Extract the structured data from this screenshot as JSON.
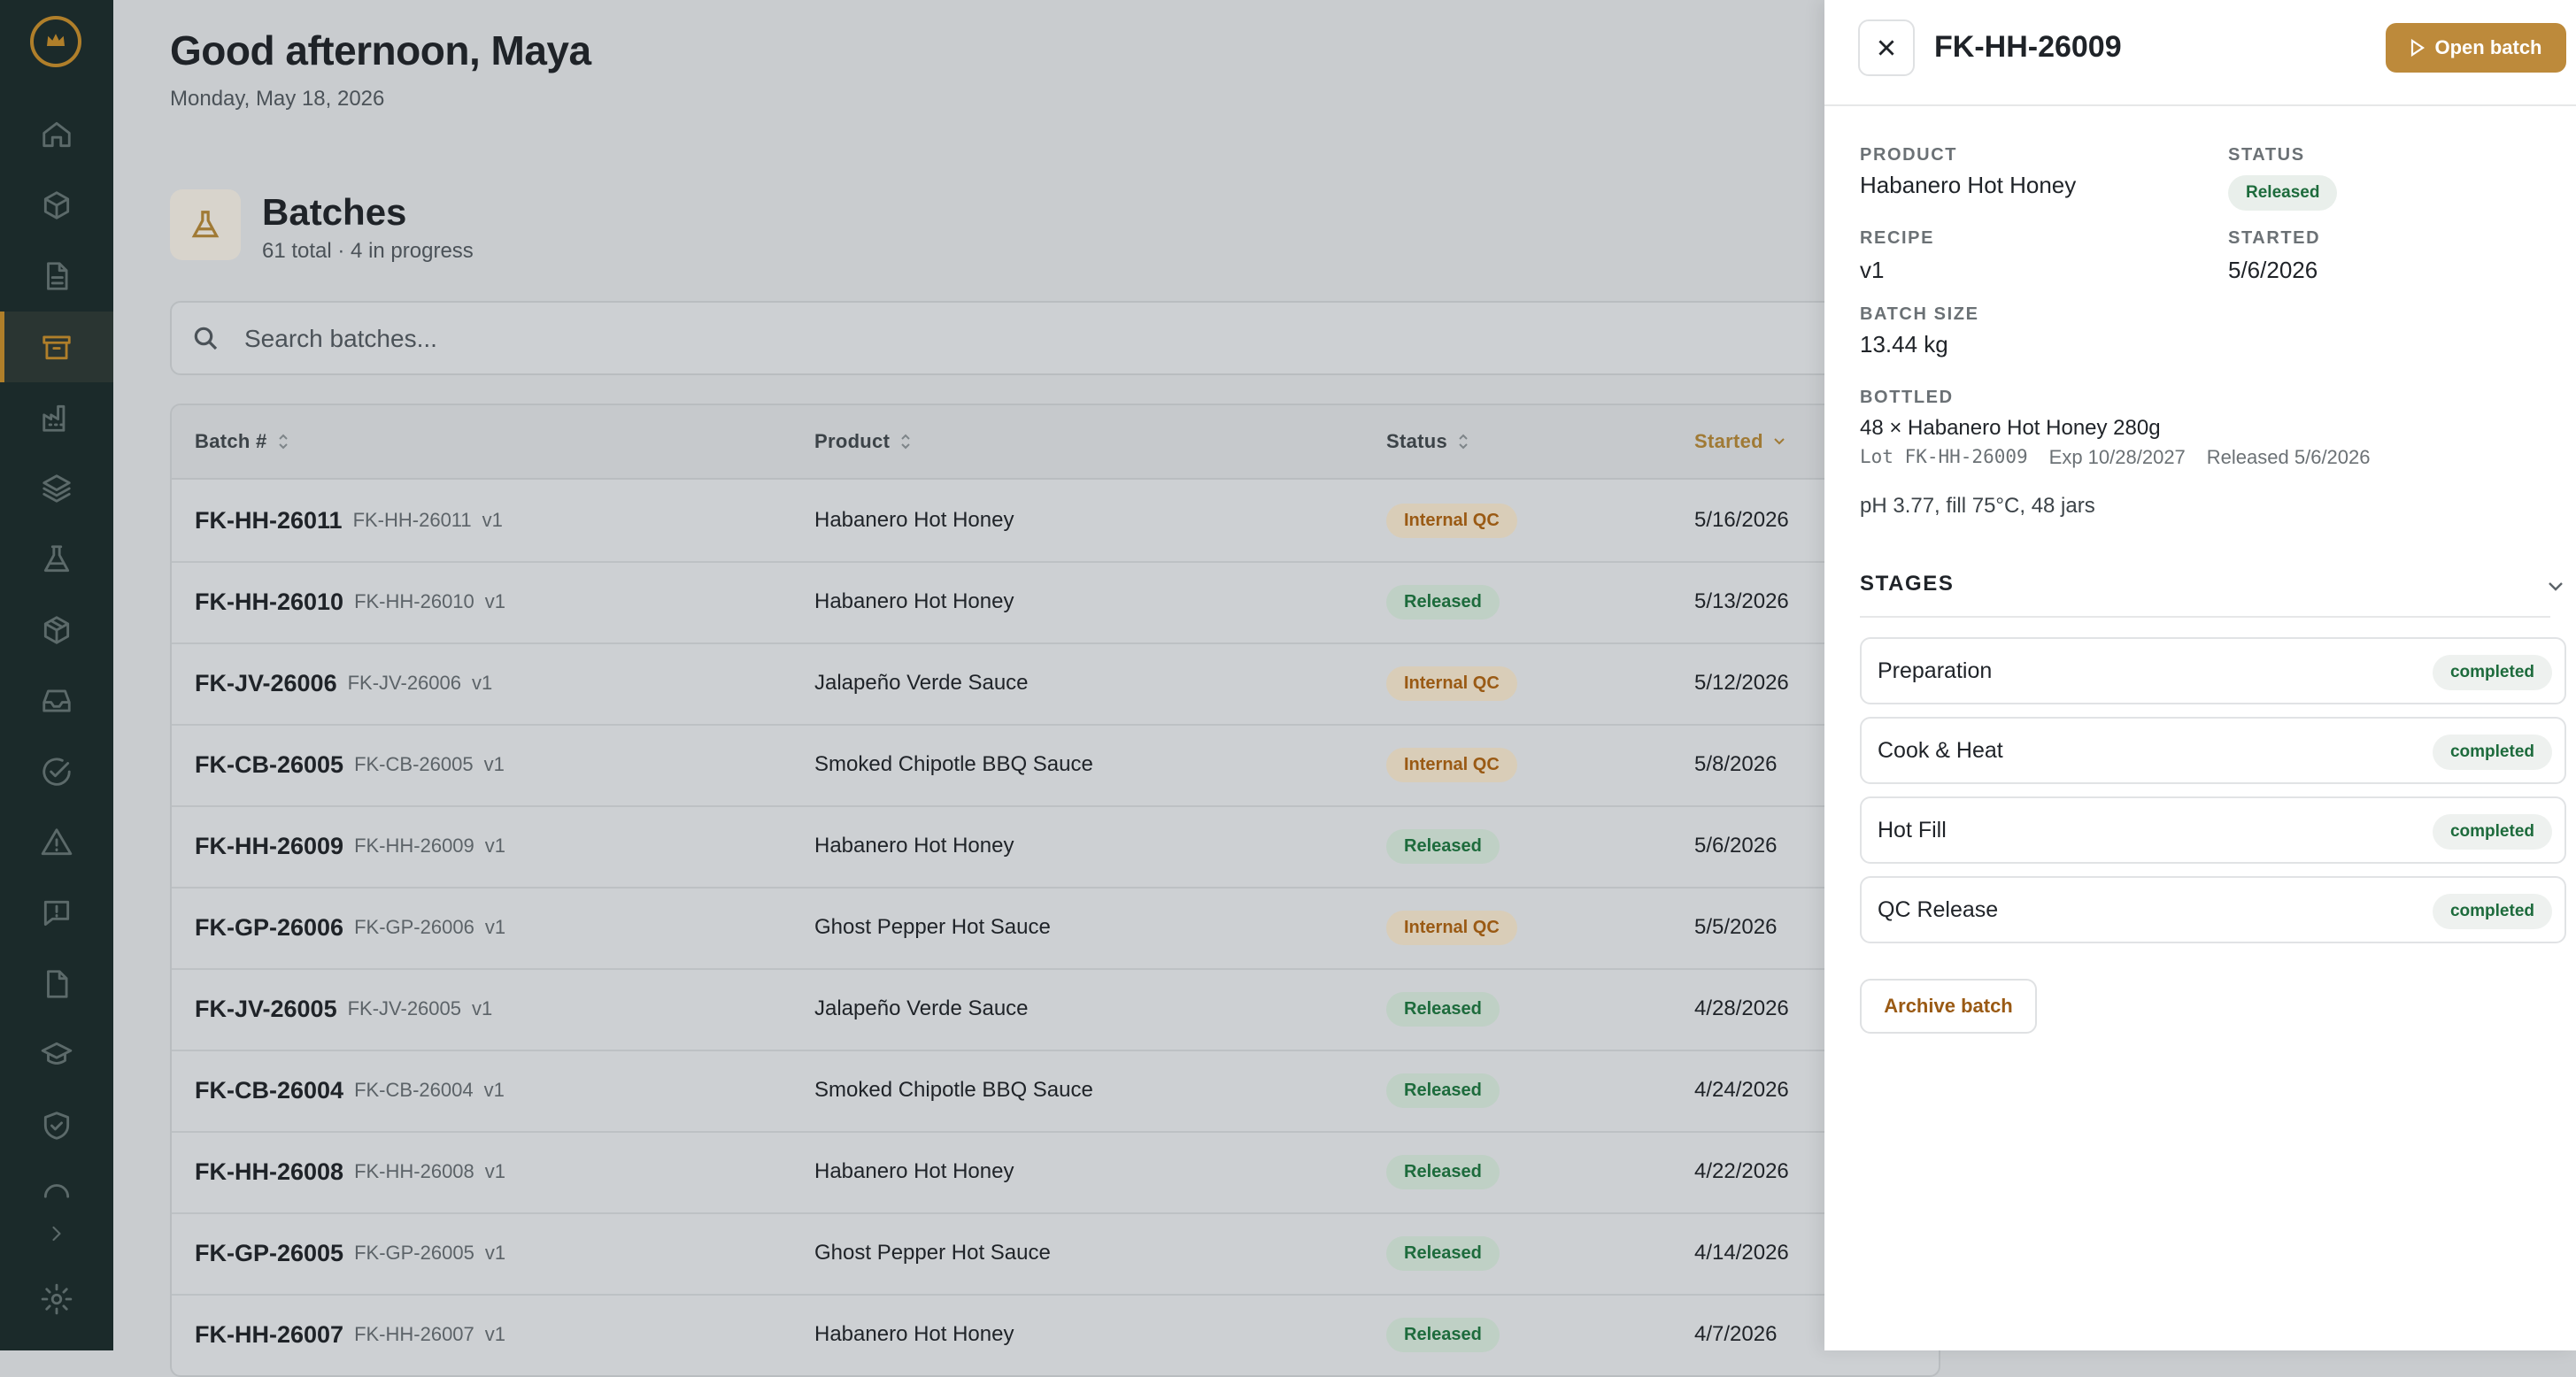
{
  "header": {
    "greeting": "Good afternoon, Maya",
    "date": "Monday, May 18, 2026"
  },
  "batches": {
    "title": "Batches",
    "subtitle": "61 total · 4 in progress"
  },
  "search": {
    "placeholder": "Search batches..."
  },
  "table": {
    "columns": {
      "batch": "Batch #",
      "product": "Product",
      "status": "Status",
      "started": "Started"
    },
    "rows": [
      {
        "batch": "FK-HH-26011",
        "sub": "FK-HH-26011",
        "ver": "v1",
        "product": "Habanero Hot Honey",
        "status": "Internal QC",
        "started": "5/16/2026"
      },
      {
        "batch": "FK-HH-26010",
        "sub": "FK-HH-26010",
        "ver": "v1",
        "product": "Habanero Hot Honey",
        "status": "Released",
        "started": "5/13/2026"
      },
      {
        "batch": "FK-JV-26006",
        "sub": "FK-JV-26006",
        "ver": "v1",
        "product": "Jalapeño Verde Sauce",
        "status": "Internal QC",
        "started": "5/12/2026"
      },
      {
        "batch": "FK-CB-26005",
        "sub": "FK-CB-26005",
        "ver": "v1",
        "product": "Smoked Chipotle BBQ Sauce",
        "status": "Internal QC",
        "started": "5/8/2026"
      },
      {
        "batch": "FK-HH-26009",
        "sub": "FK-HH-26009",
        "ver": "v1",
        "product": "Habanero Hot Honey",
        "status": "Released",
        "started": "5/6/2026"
      },
      {
        "batch": "FK-GP-26006",
        "sub": "FK-GP-26006",
        "ver": "v1",
        "product": "Ghost Pepper Hot Sauce",
        "status": "Internal QC",
        "started": "5/5/2026"
      },
      {
        "batch": "FK-JV-26005",
        "sub": "FK-JV-26005",
        "ver": "v1",
        "product": "Jalapeño Verde Sauce",
        "status": "Released",
        "started": "4/28/2026"
      },
      {
        "batch": "FK-CB-26004",
        "sub": "FK-CB-26004",
        "ver": "v1",
        "product": "Smoked Chipotle BBQ Sauce",
        "status": "Released",
        "started": "4/24/2026"
      },
      {
        "batch": "FK-HH-26008",
        "sub": "FK-HH-26008",
        "ver": "v1",
        "product": "Habanero Hot Honey",
        "status": "Released",
        "started": "4/22/2026"
      },
      {
        "batch": "FK-GP-26005",
        "sub": "FK-GP-26005",
        "ver": "v1",
        "product": "Ghost Pepper Hot Sauce",
        "status": "Released",
        "started": "4/14/2026"
      },
      {
        "batch": "FK-HH-26007",
        "sub": "FK-HH-26007",
        "ver": "v1",
        "product": "Habanero Hot Honey",
        "status": "Released",
        "started": "4/7/2026"
      }
    ]
  },
  "drawer": {
    "title": "FK-HH-26009",
    "open_label": "Open batch",
    "product_label": "PRODUCT",
    "product": "Habanero Hot Honey",
    "status_label": "STATUS",
    "status": "Released",
    "recipe_label": "RECIPE",
    "recipe": "v1",
    "started_label": "STARTED",
    "started": "5/6/2026",
    "size_label": "BATCH SIZE",
    "size": "13.44 kg",
    "bottled_label": "BOTTLED",
    "bottled": "48 × Habanero Hot Honey 280g",
    "lot": "Lot FK-HH-26009",
    "exp": "Exp 10/28/2027",
    "released": "Released 5/6/2026",
    "notes": "pH 3.77, fill 75°C, 48 jars",
    "stages_label": "STAGES",
    "stages": [
      {
        "name": "Preparation",
        "status": "completed"
      },
      {
        "name": "Cook & Heat",
        "status": "completed"
      },
      {
        "name": "Hot Fill",
        "status": "completed"
      },
      {
        "name": "QC Release",
        "status": "completed"
      }
    ],
    "archive_label": "Archive batch"
  },
  "colors": {
    "accent": "#b07f2a",
    "sidebar": "#1b2a2a",
    "released": "#1d6b3c",
    "internal_qc": "#9a5a14"
  },
  "icons": [
    "home-icon",
    "cube-icon",
    "document-icon",
    "archive-icon",
    "factory-icon",
    "layers-icon",
    "flask-icon",
    "package-icon",
    "inbox-icon",
    "check-circle-icon",
    "warning-icon",
    "message-alert-icon",
    "file-icon",
    "graduation-cap-icon",
    "shield-check-icon",
    "loader-icon",
    "chevron-right-icon",
    "settings-icon"
  ]
}
